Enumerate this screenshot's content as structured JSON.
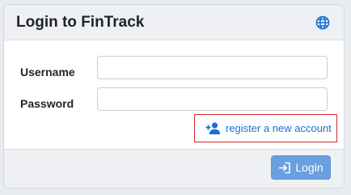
{
  "header": {
    "title": "Login to FinTrack",
    "language_icon": "globe-icon"
  },
  "form": {
    "username_label": "Username",
    "username_value": "",
    "password_label": "Password",
    "password_value": "",
    "register_label": "register a new account",
    "register_icon": "user-plus-icon"
  },
  "footer": {
    "login_label": "Login",
    "login_icon": "sign-in-icon"
  },
  "colors": {
    "accent": "#1a6fd6",
    "button": "#6a9fe0",
    "highlight_border": "#d42a2a",
    "header_bg": "#eef0f3"
  }
}
